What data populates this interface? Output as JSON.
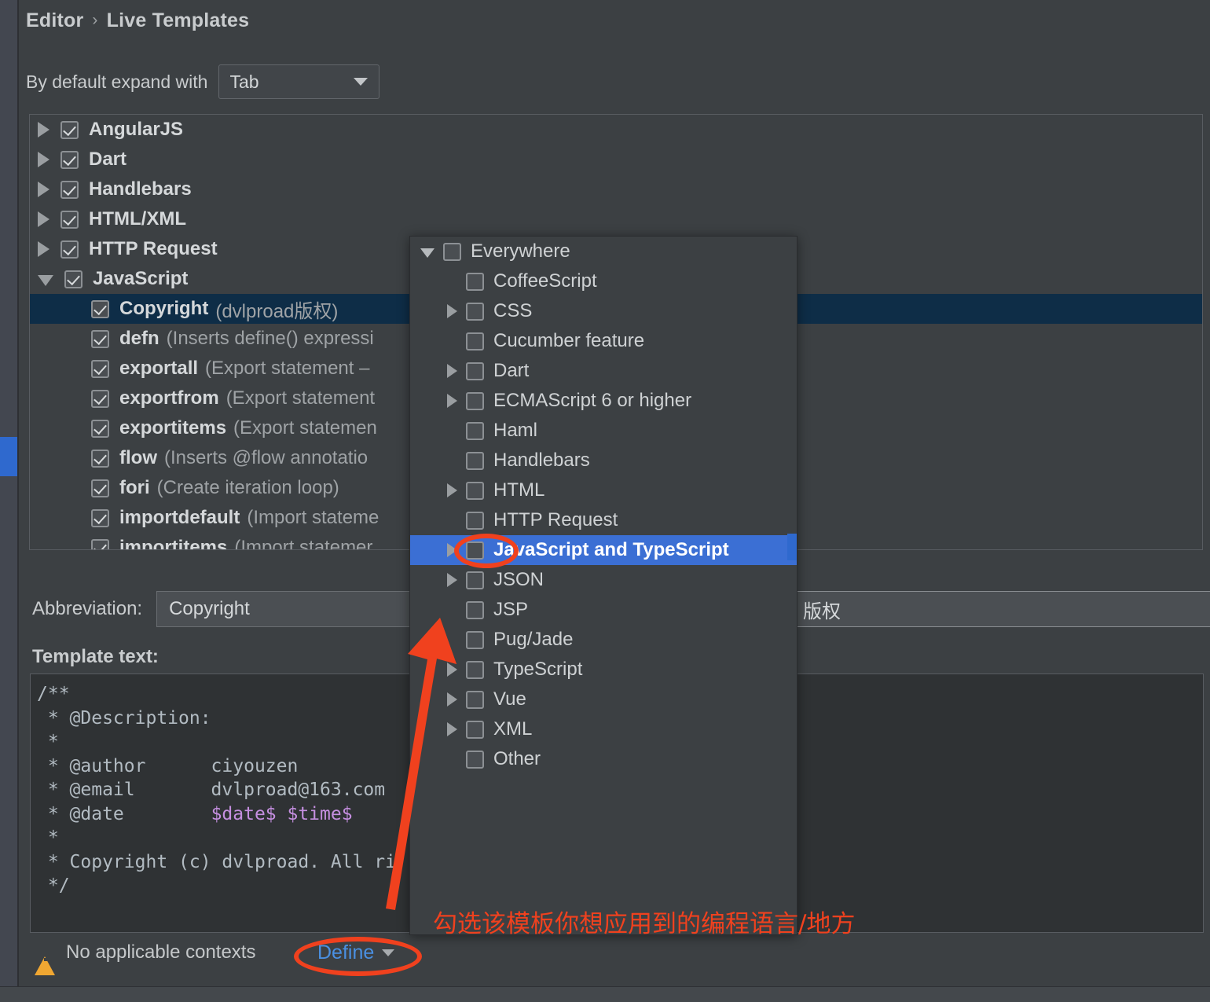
{
  "breadcrumb": {
    "root": "Editor",
    "separator": "›",
    "current": "Live Templates"
  },
  "expand": {
    "label": "By default expand with",
    "value": "Tab",
    "icon": "chevron-down-icon"
  },
  "tree": {
    "groups": [
      {
        "name": "AngularJS",
        "checked": true,
        "expanded": false
      },
      {
        "name": "Dart",
        "checked": true,
        "expanded": false
      },
      {
        "name": "Handlebars",
        "checked": true,
        "expanded": false
      },
      {
        "name": "HTML/XML",
        "checked": true,
        "expanded": false
      },
      {
        "name": "HTTP Request",
        "checked": true,
        "expanded": false
      },
      {
        "name": "JavaScript",
        "checked": true,
        "expanded": true
      }
    ],
    "items": [
      {
        "name": "Copyright",
        "desc": "(dvlproad版权)",
        "checked": true,
        "selected": true
      },
      {
        "name": "defn",
        "desc": "(Inserts define() expressi",
        "checked": true,
        "selected": false
      },
      {
        "name": "exportall",
        "desc": "(Export statement –",
        "checked": true,
        "selected": false
      },
      {
        "name": "exportfrom",
        "desc": "(Export statement",
        "checked": true,
        "selected": false
      },
      {
        "name": "exportitems",
        "desc": "(Export statemen",
        "checked": true,
        "selected": false
      },
      {
        "name": "flow",
        "desc": "(Inserts @flow annotatio",
        "checked": true,
        "selected": false
      },
      {
        "name": "fori",
        "desc": "(Create iteration loop)",
        "checked": true,
        "selected": false
      },
      {
        "name": "importdefault",
        "desc": "(Import stateme",
        "checked": true,
        "selected": false
      },
      {
        "name": "importitems",
        "desc": "(Import statemer",
        "checked": true,
        "selected": false
      }
    ]
  },
  "abbreviation": {
    "label": "Abbreviation:",
    "value": "Copyright"
  },
  "description": {
    "value": "版权"
  },
  "template_text": {
    "label": "Template text:",
    "lines": [
      "/**",
      " * @Description:",
      " *",
      " * @author      ciyouzen",
      " * @email       dvlproad@163.com",
      " * @date        ",
      " *",
      " * Copyright (c) dvlproad. All ri",
      " */"
    ],
    "date_variables": "$date$ $time$"
  },
  "footer": {
    "warning_icon": "warning-triangle-icon",
    "warning_text": "No applicable contexts",
    "define_label": "Define",
    "define_chevron": "chevron-down-icon"
  },
  "context_popup": {
    "rows": [
      {
        "label": "Everywhere",
        "level": 0,
        "arrow": "down",
        "checked": false,
        "selected": false
      },
      {
        "label": "CoffeeScript",
        "level": 1,
        "arrow": "none",
        "checked": false,
        "selected": false
      },
      {
        "label": "CSS",
        "level": 1,
        "arrow": "right",
        "checked": false,
        "selected": false
      },
      {
        "label": "Cucumber feature",
        "level": 1,
        "arrow": "none",
        "checked": false,
        "selected": false
      },
      {
        "label": "Dart",
        "level": 1,
        "arrow": "right",
        "checked": false,
        "selected": false
      },
      {
        "label": "ECMAScript 6 or higher",
        "level": 1,
        "arrow": "right",
        "checked": false,
        "selected": false
      },
      {
        "label": "Haml",
        "level": 1,
        "arrow": "none",
        "checked": false,
        "selected": false
      },
      {
        "label": "Handlebars",
        "level": 1,
        "arrow": "none",
        "checked": false,
        "selected": false
      },
      {
        "label": "HTML",
        "level": 1,
        "arrow": "right",
        "checked": false,
        "selected": false
      },
      {
        "label": "HTTP Request",
        "level": 1,
        "arrow": "none",
        "checked": false,
        "selected": false
      },
      {
        "label": "JavaScript and TypeScript",
        "level": 1,
        "arrow": "right",
        "checked": false,
        "selected": true
      },
      {
        "label": "JSON",
        "level": 1,
        "arrow": "right",
        "checked": false,
        "selected": false
      },
      {
        "label": "JSP",
        "level": 1,
        "arrow": "none",
        "checked": false,
        "selected": false
      },
      {
        "label": "Pug/Jade",
        "level": 1,
        "arrow": "none",
        "checked": false,
        "selected": false
      },
      {
        "label": "TypeScript",
        "level": 1,
        "arrow": "right",
        "checked": false,
        "selected": false
      },
      {
        "label": "Vue",
        "level": 1,
        "arrow": "right",
        "checked": false,
        "selected": false
      },
      {
        "label": "XML",
        "level": 1,
        "arrow": "right",
        "checked": false,
        "selected": false
      },
      {
        "label": "Other",
        "level": 1,
        "arrow": "none",
        "checked": false,
        "selected": false
      }
    ]
  },
  "annotation": {
    "note": "勾选该模板你想应用到的编程语言/地方",
    "color": "#F0411E",
    "arrow": "red-arrow-up",
    "ellipses": [
      "define-button-ellipse",
      "javascript-checkbox-ellipse"
    ]
  },
  "colors": {
    "window_bg": "#3C4043",
    "selection_tree": "#0E2D47",
    "selection_popup": "#3B6FD4",
    "link": "#4A90E2",
    "scrollbar": "#2F69CE",
    "warning": "#F0A732",
    "annotation_red": "#F0411E",
    "editor_bg": "#2F3234",
    "template_var": "#C58FE0"
  }
}
